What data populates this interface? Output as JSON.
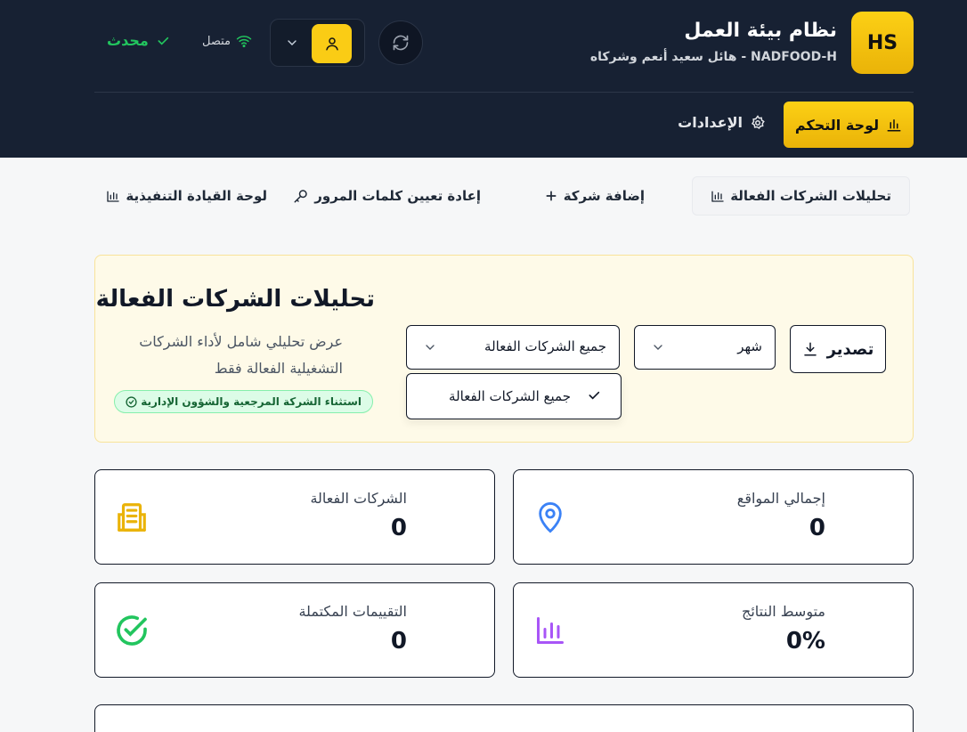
{
  "header": {
    "logo_text": "HS",
    "title": "نظام بيئة العمل",
    "subtitle": "NADFOOD-H - هائل سعيد أنعم وشركاه",
    "status_online": "متصل",
    "status_updated": "محدث",
    "nav": {
      "dashboard_label": "لوحة التحكم",
      "settings_label": "الإعدادات"
    }
  },
  "tabs": [
    {
      "label": "تحليلات الشركات الفعالة",
      "icon": "chart-icon",
      "active": true
    },
    {
      "label": "إضافة شركة",
      "icon": "plus-icon",
      "active": false
    },
    {
      "label": "إعادة تعيين كلمات المرور",
      "icon": "key-icon",
      "active": false
    },
    {
      "label": "لوحة القيادة التنفيذية",
      "icon": "chart-icon",
      "active": false
    }
  ],
  "panel": {
    "title": "تحليلات الشركات الفعالة",
    "description": "عرض تحليلي شامل لأداء الشركات التشغيلية الفعالة فقط",
    "badge": "استثناء الشركة المرجعية والشؤون الإدارية",
    "export_label": "تصدير",
    "period_select": {
      "value": "شهر"
    },
    "company_select": {
      "value": "جميع الشركات الفعالة"
    },
    "dropdown_options": [
      "جميع الشركات الفعالة"
    ]
  },
  "stats": [
    {
      "label": "إجمالي المواقع",
      "value": "0",
      "icon": "map-pin-icon",
      "color": "#3b82f6"
    },
    {
      "label": "الشركات الفعالة",
      "value": "0",
      "icon": "building-icon",
      "color": "#eab308"
    },
    {
      "label": "متوسط النتائج",
      "value": "0%",
      "icon": "bar-chart-icon",
      "color": "#a855f7"
    },
    {
      "label": "التقييمات المكتملة",
      "value": "0",
      "icon": "check-circle-icon",
      "color": "#22c55e"
    }
  ],
  "colors": {
    "header_bg": "#172133",
    "accent": "#facc15",
    "success": "#22c55e"
  }
}
